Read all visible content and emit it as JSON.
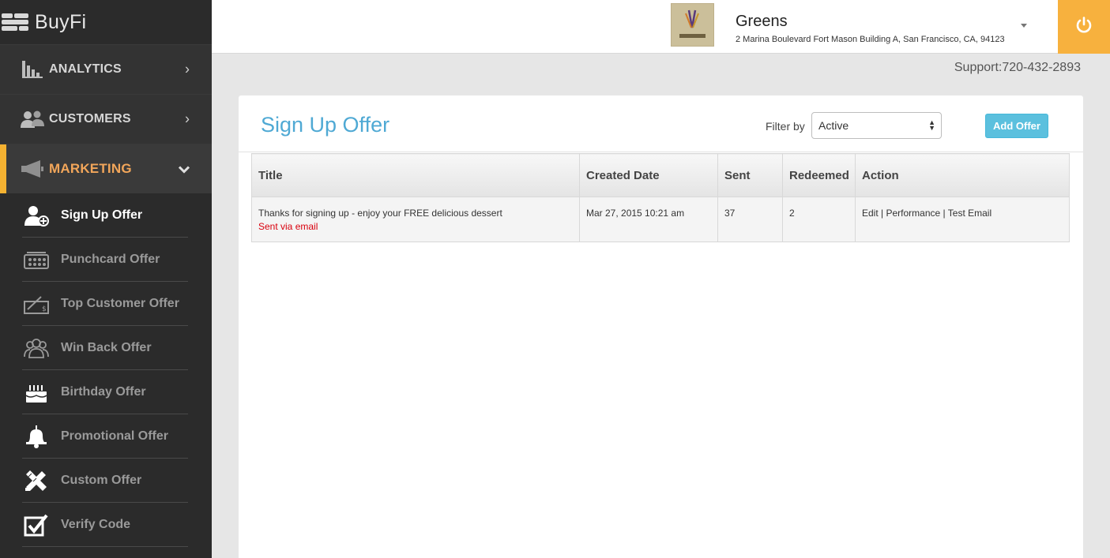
{
  "app": {
    "name": "BuyFi"
  },
  "sidebar": {
    "nav": [
      {
        "label": "ANALYTICS",
        "icon": "bar-chart-icon",
        "chevron": "›"
      },
      {
        "label": "CUSTOMERS",
        "icon": "users-icon",
        "chevron": "›"
      },
      {
        "label": "MARKETING",
        "icon": "megaphone-icon",
        "chevron": "⌄"
      }
    ],
    "items": [
      {
        "label": "Sign Up Offer",
        "icon": "add-user-icon"
      },
      {
        "label": "Punchcard Offer",
        "icon": "punchcard-icon"
      },
      {
        "label": "Top Customer Offer",
        "icon": "check-signature-icon"
      },
      {
        "label": "Win Back Offer",
        "icon": "group-icon"
      },
      {
        "label": "Birthday Offer",
        "icon": "cake-icon"
      },
      {
        "label": "Promotional Offer",
        "icon": "bell-icon"
      },
      {
        "label": "Custom Offer",
        "icon": "tools-icon"
      },
      {
        "label": "Verify Code",
        "icon": "checkbox-icon"
      }
    ]
  },
  "header": {
    "store_name": "Greens",
    "store_address": "2 Marina Boulevard Fort Mason Building A, San Francisco, CA, 94123",
    "support": "Support:720-432-2893"
  },
  "main": {
    "title": "Sign Up Offer",
    "filter_label": "Filter by",
    "filter_value": "Active",
    "add_button": "Add Offer",
    "columns": [
      "Title",
      "Created Date",
      "Sent",
      "Redeemed",
      "Action"
    ],
    "rows": [
      {
        "title": "Thanks for signing up - enjoy your FREE delicious dessert",
        "channel": "Sent via email",
        "created": "Mar 27, 2015 10:21 am",
        "sent": "37",
        "redeemed": "2",
        "action_edit": "Edit",
        "action_sep": " | ",
        "action_performance": "Performance",
        "action_test": "Test Email"
      }
    ]
  },
  "colors": {
    "accent": "#4fa9d4",
    "active_nav": "#f2a65a",
    "power": "#f7b13e",
    "button": "#5bc0de",
    "sent_via": "#d9000d"
  }
}
